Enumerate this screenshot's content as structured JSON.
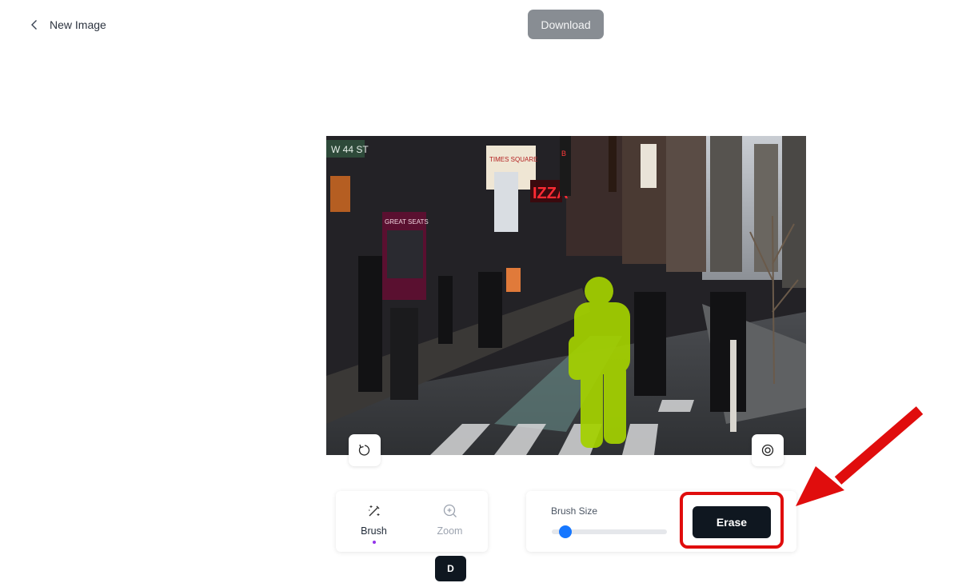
{
  "header": {
    "back_label": "New Image",
    "back_icon": "chevron-left-icon",
    "download_label": "Download"
  },
  "canvas": {
    "description": "Busy city street (Times Square) photo with one pedestrian masked in lime green",
    "mask_color": "#a4d100",
    "signs": [
      "W 44 ST",
      "TIMES SQUARE",
      "PIZZA",
      "GREAT SEATS",
      "BAR"
    ],
    "undo_icon": "rotate-ccw-icon",
    "preview_icon": "eye-icon"
  },
  "tools": {
    "items": [
      {
        "label": "Brush",
        "icon": "magic-wand-icon",
        "active": true
      },
      {
        "label": "Zoom",
        "icon": "zoom-in-icon",
        "active": false
      }
    ],
    "shortcut_key": "D",
    "active_indicator_color": "#9333ea"
  },
  "brush": {
    "label": "Brush Size",
    "value_fraction": 0.12,
    "thumb_color": "#1677ff"
  },
  "actions": {
    "erase_label": "Erase"
  },
  "annotation": {
    "color": "#e00d0d",
    "target": "Erase button"
  }
}
